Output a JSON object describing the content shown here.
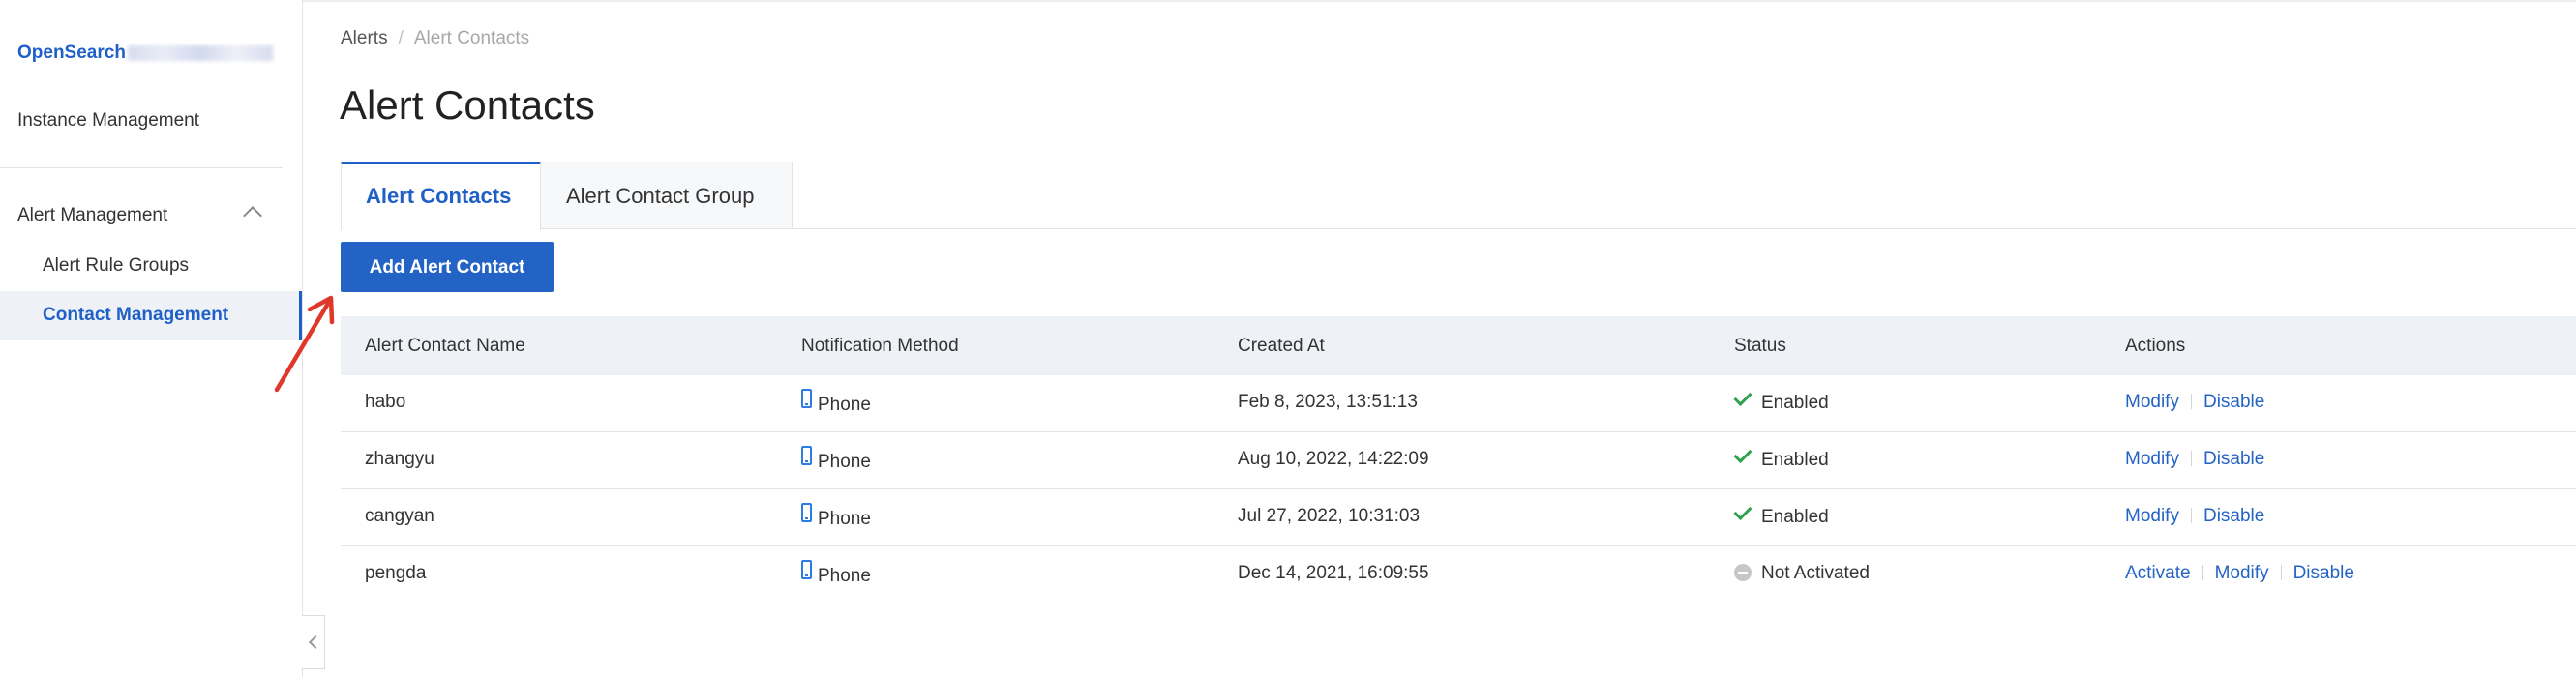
{
  "sidebar": {
    "product_name": "OpenSearch",
    "items": [
      {
        "label": "Instance Management"
      },
      {
        "label": "Alert Management"
      }
    ],
    "sub_items": [
      {
        "label": "Alert Rule Groups"
      },
      {
        "label": "Contact Management"
      }
    ]
  },
  "breadcrumb": {
    "root": "Alerts",
    "separator": "/",
    "current": "Alert Contacts"
  },
  "page_title": "Alert Contacts",
  "tabs": [
    {
      "label": "Alert Contacts"
    },
    {
      "label": "Alert Contact Group"
    }
  ],
  "toolbar": {
    "add_label": "Add Alert Contact"
  },
  "table": {
    "columns": [
      "Alert Contact Name",
      "Notification Method",
      "Created At",
      "Status",
      "Actions"
    ],
    "rows": [
      {
        "name": "habo",
        "method": "Phone",
        "created": "Feb 8, 2023, 13:51:13",
        "status": "Enabled",
        "actions": [
          "Modify",
          "Disable"
        ]
      },
      {
        "name": "zhangyu",
        "method": "Phone",
        "created": "Aug 10, 2022, 14:22:09",
        "status": "Enabled",
        "actions": [
          "Modify",
          "Disable"
        ]
      },
      {
        "name": "cangyan",
        "method": "Phone",
        "created": "Jul 27, 2022, 10:31:03",
        "status": "Enabled",
        "actions": [
          "Modify",
          "Disable"
        ]
      },
      {
        "name": "pengda",
        "method": "Phone",
        "created": "Dec 14, 2021, 16:09:55",
        "status": "Not Activated",
        "actions": [
          "Activate",
          "Modify",
          "Disable"
        ]
      }
    ]
  },
  "colors": {
    "accent": "#2463c6",
    "success": "#30a14e",
    "annotation_arrow": "#e0372b",
    "top_accent": "#ff6a00"
  },
  "icons": {
    "phone": "phone-icon",
    "enabled": "check-icon",
    "not_activated": "minus-circle-icon",
    "collapse": "chevron-left-icon",
    "expand": "chevron-up-icon"
  }
}
